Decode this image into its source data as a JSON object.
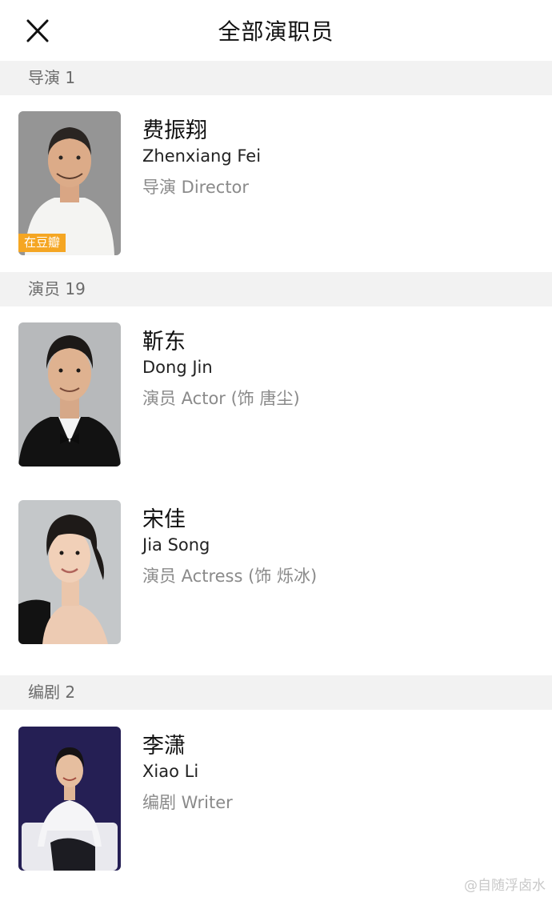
{
  "header": {
    "title": "全部演职员",
    "close_icon": "close-icon"
  },
  "sections": [
    {
      "label": "导演 1",
      "people": [
        {
          "name_zh": "费振翔",
          "name_en": "Zhenxiang Fei",
          "role": "导演 Director",
          "badge": "在豆瓣"
        }
      ]
    },
    {
      "label": "演员 19",
      "people": [
        {
          "name_zh": "靳东",
          "name_en": "Dong Jin",
          "role": "演员 Actor (饰 唐尘)"
        },
        {
          "name_zh": "宋佳",
          "name_en": "Jia Song",
          "role": "演员 Actress (饰 烁冰)"
        }
      ]
    },
    {
      "label": "编剧 2",
      "people": [
        {
          "name_zh": "李潇",
          "name_en": "Xiao Li",
          "role": "编剧 Writer"
        }
      ]
    }
  ],
  "watermark": "@自随浮卤水",
  "colors": {
    "section_bg": "#f2f2f2",
    "badge": "#f5a623",
    "secondary_text": "#8a8a8a"
  }
}
